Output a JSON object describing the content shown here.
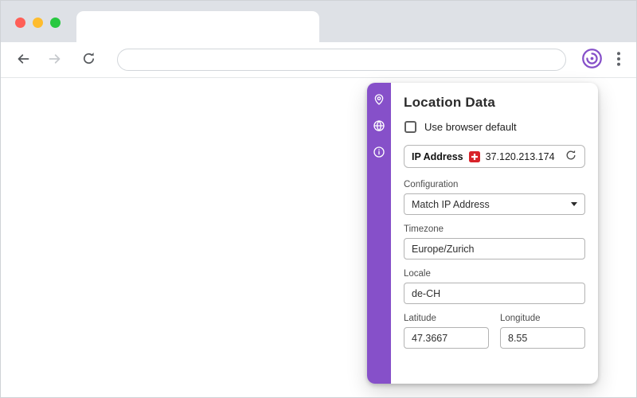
{
  "colors": {
    "accent": "#8650c9",
    "flag_red": "#d8232a",
    "traffic_red": "#ff5f57",
    "traffic_yellow": "#febc2e",
    "traffic_green": "#28c840"
  },
  "browser": {
    "tab_title": "",
    "url_value": ""
  },
  "panel": {
    "title": "Location Data",
    "browser_default": {
      "label": "Use browser default",
      "checked": false
    },
    "ip_row": {
      "label": "IP Address",
      "value": "37.120.213.174",
      "flag": "switzerland-flag"
    },
    "configuration": {
      "label": "Configuration",
      "value": "Match IP Address"
    },
    "timezone": {
      "label": "Timezone",
      "value": "Europe/Zurich"
    },
    "locale": {
      "label": "Locale",
      "value": "de-CH"
    },
    "latitude": {
      "label": "Latitude",
      "value": "47.3667"
    },
    "longitude": {
      "label": "Longitude",
      "value": "8.55"
    },
    "rail_icons": [
      "location-pin",
      "globe",
      "info"
    ]
  }
}
